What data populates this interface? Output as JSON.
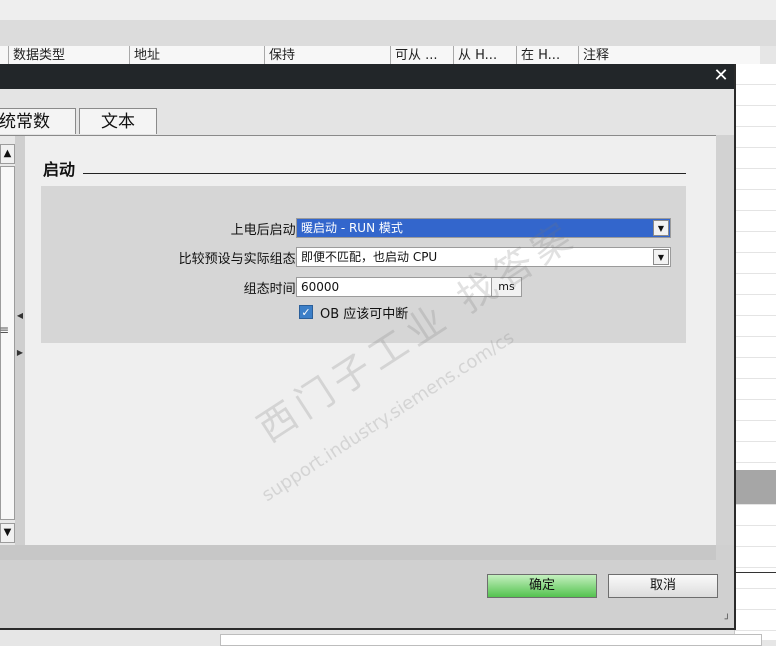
{
  "background_table": {
    "columns": [
      "数据类型",
      "地址",
      "保持",
      "可从 ...",
      "从 H...",
      "在 H...",
      "注释"
    ]
  },
  "dialog": {
    "close_glyph": "✕",
    "tabs": [
      "统常数",
      "文本"
    ],
    "section_title": "启动",
    "settings": {
      "startup_label": "上电后启动:",
      "startup_value": "暖启动 - RUN 模式",
      "compare_label": "比较预设与实际组态:",
      "compare_value": "即便不匹配，也启动 CPU",
      "config_time_label": "组态时间:",
      "config_time_value": "60000",
      "config_time_unit": "ms",
      "ob_interrupt_label": "OB 应该可中断",
      "ob_interrupt_checked": true
    },
    "buttons": {
      "ok": "确定",
      "cancel": "取消"
    },
    "watermark": {
      "line1": "西门子工业  找答案",
      "line2": "support.industry.siemens.com/cs"
    }
  },
  "colors": {
    "titlebar": "#222629",
    "selected_dropdown": "#3366cc",
    "ok_button": "#54c24f",
    "checkbox": "#3c7fc8"
  }
}
